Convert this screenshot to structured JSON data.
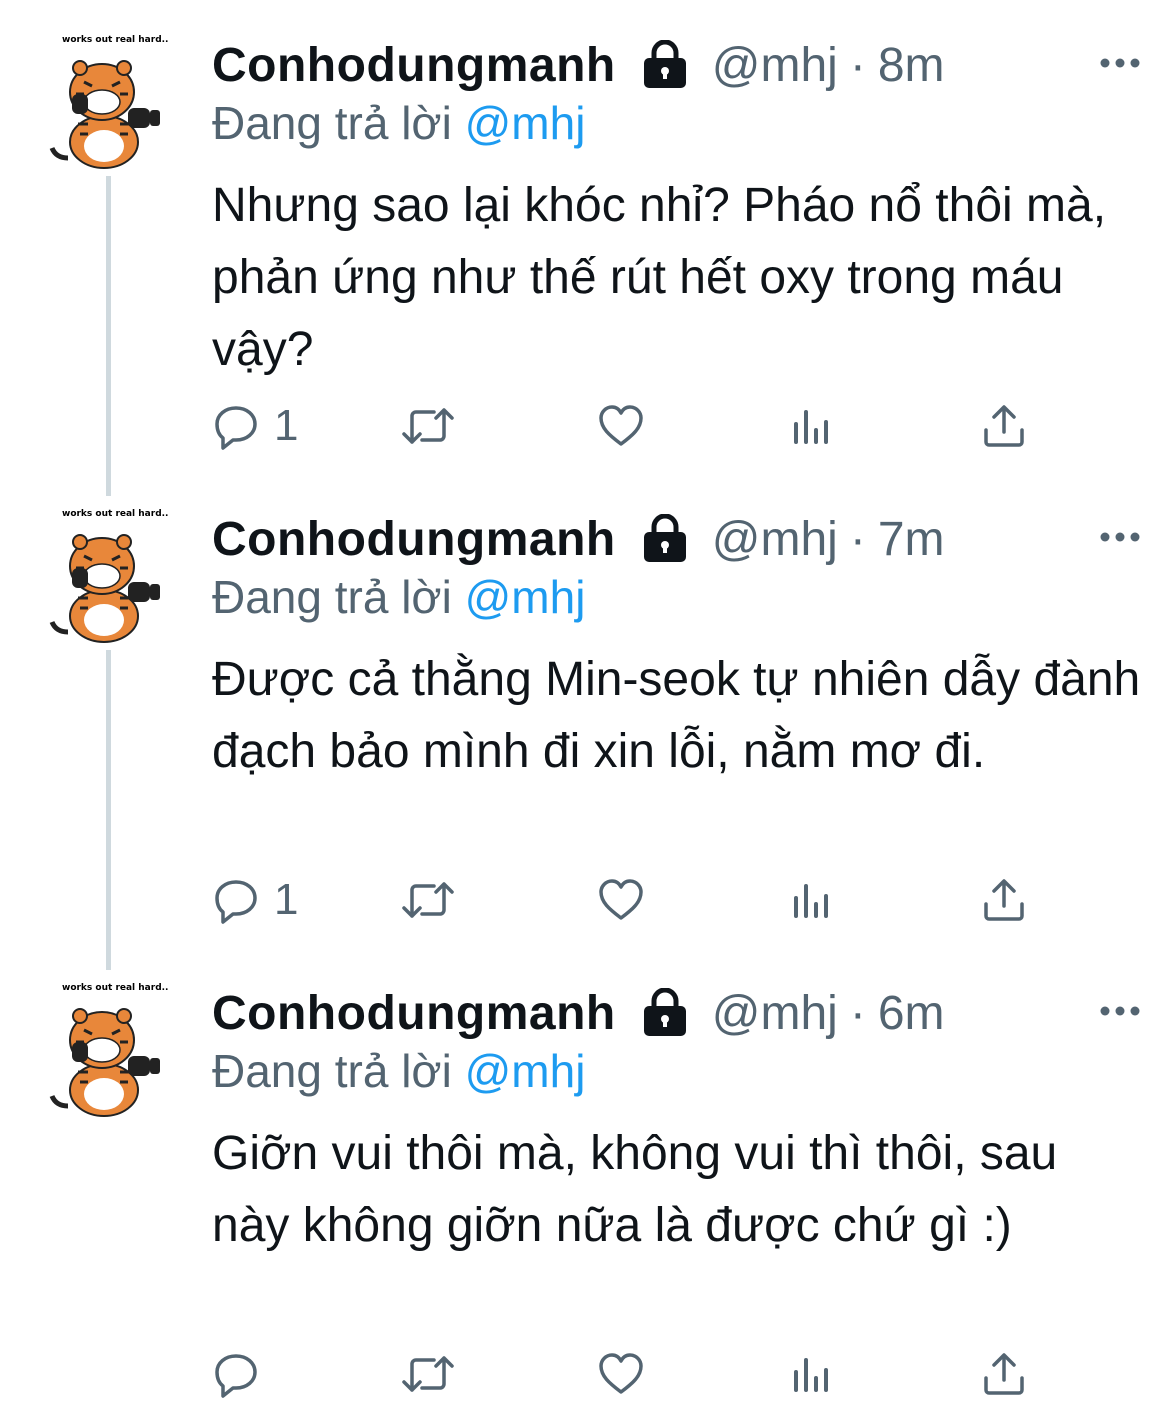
{
  "tweets": [
    {
      "avatar_caption": "works out real hard..",
      "display_name": "Conhodungmanh",
      "handle": "@mhj",
      "separator": "·",
      "time": "8m",
      "replying_prefix": "Đang trả lời",
      "replying_to": "@mhj",
      "text": "Nhưng sao lại khóc nhỉ? Pháo nổ thôi mà, phản ứng như thế rút hết oxy trong máu vậy?",
      "reply_count": "1"
    },
    {
      "avatar_caption": "works out real hard..",
      "display_name": "Conhodungmanh",
      "handle": "@mhj",
      "separator": "·",
      "time": "7m",
      "replying_prefix": "Đang trả lời",
      "replying_to": "@mhj",
      "text": "Được cả thằng Min-seok tự nhiên dẫy đành đạch bảo mình đi xin lỗi, nằm mơ đi.",
      "reply_count": "1"
    },
    {
      "avatar_caption": "works out real hard..",
      "display_name": "Conhodungmanh",
      "handle": "@mhj",
      "separator": "·",
      "time": "6m",
      "replying_prefix": "Đang trả lời",
      "replying_to": "@mhj",
      "text": "Giỡn vui thôi mà, không vui thì thôi, sau này không giỡn nữa là được chứ gì :)",
      "reply_count": ""
    }
  ],
  "icons": {
    "lock": "lock-icon",
    "more": "more-options-icon",
    "reply": "reply-icon",
    "retweet": "retweet-icon",
    "like": "heart-icon",
    "views": "analytics-icon",
    "share": "share-icon"
  },
  "colors": {
    "text": "#0f1419",
    "secondary": "#536471",
    "mention": "#1d9bf0",
    "thread_line": "#cfd9de",
    "tiger_orange": "#e8873a"
  }
}
